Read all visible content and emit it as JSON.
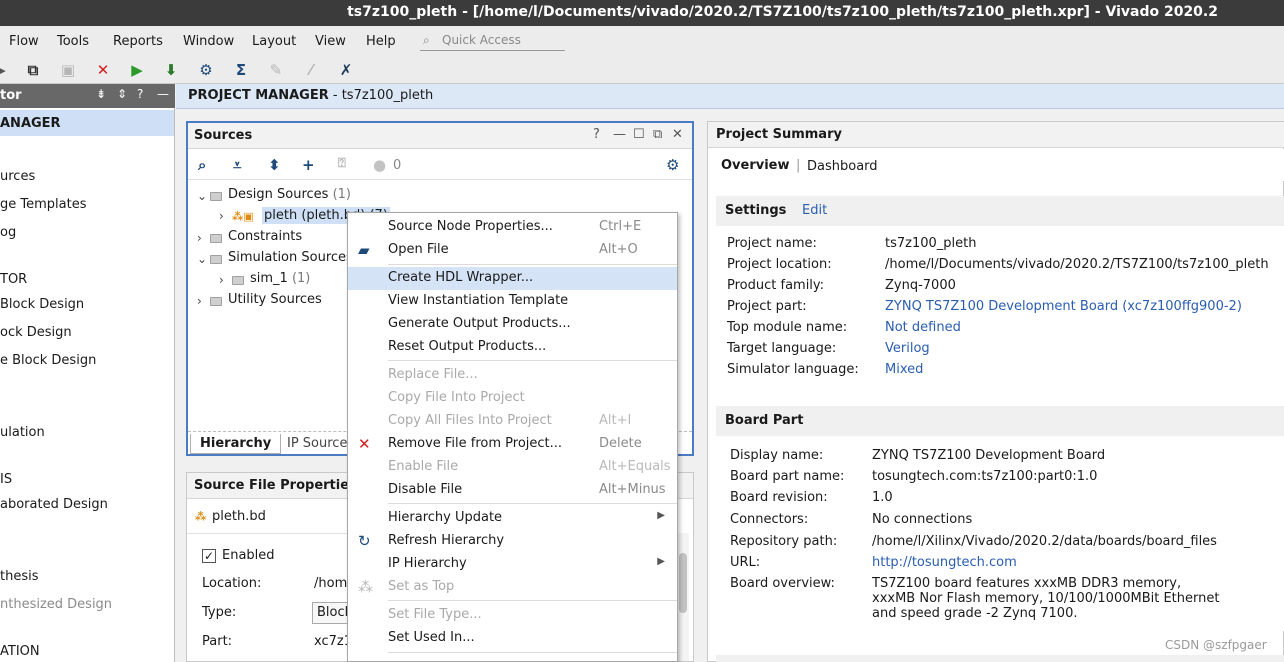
{
  "window": {
    "title": "ts7z100_pleth - [/home/l/Documents/vivado/2020.2/TS7Z100/ts7z100_pleth/ts7z100_pleth.xpr] - Vivado 2020.2"
  },
  "menu": [
    "Flow",
    "Tools",
    "Reports",
    "Window",
    "Layout",
    "View",
    "Help"
  ],
  "quick_access": {
    "placeholder": "Quick Access"
  },
  "toolbar": {
    "icons": [
      "copy-icon",
      "paste-icon",
      "delete-icon",
      "run-icon",
      "bitstream-icon",
      "settings-icon",
      "sigma-icon",
      "pin-icon",
      "wand-icon",
      "tool-icon"
    ]
  },
  "flow_navigator": {
    "header": "tor",
    "items": [
      {
        "label": "ANAGER",
        "style": "head",
        "selected": true
      },
      {
        "label": "urces",
        "style": "normal"
      },
      {
        "label": "ge Templates",
        "style": "normal"
      },
      {
        "label": "og",
        "style": "normal"
      },
      {
        "label": "TOR",
        "style": "normal"
      },
      {
        "label": "Block Design",
        "style": "normal"
      },
      {
        "label": "ock Design",
        "style": "normal"
      },
      {
        "label": "e Block Design",
        "style": "normal"
      },
      {
        "label": "ulation",
        "style": "normal"
      },
      {
        "label": "IS",
        "style": "normal"
      },
      {
        "label": "aborated Design",
        "style": "normal"
      },
      {
        "label": "thesis",
        "style": "normal"
      },
      {
        "label": "nthesized Design",
        "style": "gray"
      },
      {
        "label": "ATION",
        "style": "normal"
      }
    ]
  },
  "project_manager": {
    "title": "PROJECT MANAGER",
    "suffix": " - ts7z100_pleth"
  },
  "sources": {
    "title": "Sources",
    "status_count": "0",
    "tree": {
      "design_sources": {
        "label": "Design Sources",
        "count": "(1)"
      },
      "pleth": {
        "label": "pleth (pleth.bd) (7)"
      },
      "constraints": {
        "label": "Constraints"
      },
      "simulation_sources": {
        "label": "Simulation Sources"
      },
      "sim_1": {
        "label": "sim_1",
        "count": "(1)"
      },
      "utility_sources": {
        "label": "Utility Sources"
      }
    },
    "tabs": [
      "Hierarchy",
      "IP Source"
    ]
  },
  "source_file_properties": {
    "title": "Source File Properties",
    "file": "pleth.bd",
    "enabled_label": "Enabled",
    "location_label": "Location:",
    "location_value": "/home",
    "type_label": "Type:",
    "type_value": "Block",
    "part_label": "Part:",
    "part_value": "xc7z1"
  },
  "context_menu": {
    "items": [
      {
        "label": "Source Node Properties...",
        "shortcut": "Ctrl+E",
        "disabled": false
      },
      {
        "label": "Open File",
        "shortcut": "Alt+O",
        "disabled": false,
        "icon": "open-file-icon"
      },
      {
        "label": "Create HDL Wrapper...",
        "shortcut": "",
        "disabled": false,
        "hover": true
      },
      {
        "label": "View Instantiation Template",
        "shortcut": "",
        "disabled": false
      },
      {
        "label": "Generate Output Products...",
        "shortcut": "",
        "disabled": false
      },
      {
        "label": "Reset Output Products...",
        "shortcut": "",
        "disabled": false
      },
      {
        "label": "Replace File...",
        "shortcut": "",
        "disabled": true
      },
      {
        "label": "Copy File Into Project",
        "shortcut": "",
        "disabled": true
      },
      {
        "label": "Copy All Files Into Project",
        "shortcut": "Alt+I",
        "disabled": true
      },
      {
        "label": "Remove File from Project...",
        "shortcut": "Delete",
        "disabled": false,
        "icon": "remove-icon"
      },
      {
        "label": "Enable File",
        "shortcut": "Alt+Equals",
        "disabled": true
      },
      {
        "label": "Disable File",
        "shortcut": "Alt+Minus",
        "disabled": false
      },
      {
        "label": "Hierarchy Update",
        "shortcut": "",
        "disabled": false,
        "submenu": true
      },
      {
        "label": "Refresh Hierarchy",
        "shortcut": "",
        "disabled": false,
        "icon": "refresh-icon"
      },
      {
        "label": "IP Hierarchy",
        "shortcut": "",
        "disabled": false,
        "submenu": true
      },
      {
        "label": "Set as Top",
        "shortcut": "",
        "disabled": true,
        "icon": "hierarchy-icon"
      },
      {
        "label": "Set File Type...",
        "shortcut": "",
        "disabled": true
      },
      {
        "label": "Set Used In...",
        "shortcut": "",
        "disabled": false
      }
    ]
  },
  "project_summary": {
    "title": "Project Summary",
    "tabs": {
      "overview": "Overview",
      "dashboard": "Dashboard"
    },
    "settings": {
      "title": "Settings",
      "edit": "Edit",
      "rows": [
        {
          "key": "Project name:",
          "value": "ts7z100_pleth",
          "link": false
        },
        {
          "key": "Project location:",
          "value": "/home/l/Documents/vivado/2020.2/TS7Z100/ts7z100_pleth",
          "link": false
        },
        {
          "key": "Product family:",
          "value": "Zynq-7000",
          "link": false
        },
        {
          "key": "Project part:",
          "value": "ZYNQ TS7Z100 Development Board (xc7z100ffg900-2)",
          "link": true
        },
        {
          "key": "Top module name:",
          "value": "Not defined",
          "link": true
        },
        {
          "key": "Target language:",
          "value": "Verilog",
          "link": true
        },
        {
          "key": "Simulator language:",
          "value": "Mixed",
          "link": true
        }
      ]
    },
    "board_part": {
      "title": "Board Part",
      "rows": [
        {
          "key": "Display name:",
          "value": "ZYNQ TS7Z100 Development Board",
          "link": false
        },
        {
          "key": "Board part name:",
          "value": "tosungtech.com:ts7z100:part0:1.0",
          "link": false
        },
        {
          "key": "Board revision:",
          "value": "1.0",
          "link": false
        },
        {
          "key": "Connectors:",
          "value": "No connections",
          "link": false
        },
        {
          "key": "Repository path:",
          "value": "/home/l/Xilinx/Vivado/2020.2/data/boards/board_files",
          "link": false
        },
        {
          "key": "URL:",
          "value": "http://tosungtech.com",
          "link": true
        },
        {
          "key": "Board overview:",
          "value": "TS7Z100 board features xxxMB DDR3 memory,",
          "link": false
        }
      ],
      "overview_lines": [
        "xxxMB Nor Flash memory, 10/100/1000MBit Ethernet",
        "and speed grade -2 Zynq 7100."
      ]
    }
  },
  "watermark": "CSDN @szfpgaer",
  "colors": {
    "link": "#2a5db0",
    "accent_border": "#4a7bc4",
    "selection": "#cfe0f6"
  }
}
